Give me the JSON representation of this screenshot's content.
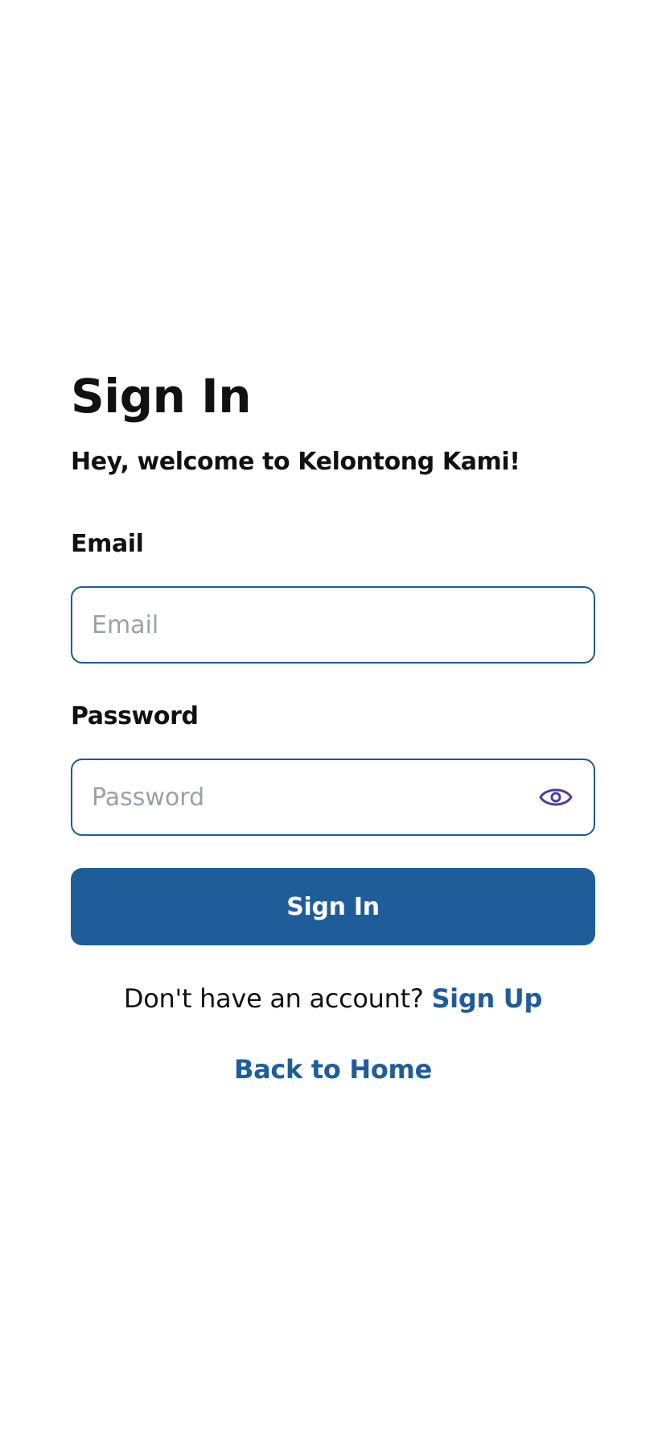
{
  "page": {
    "title": "Sign In",
    "subtitle": "Hey, welcome to Kelontong Kami!"
  },
  "form": {
    "email_label": "Email",
    "email_placeholder": "Email",
    "email_value": "",
    "password_label": "Password",
    "password_placeholder": "Password",
    "password_value": "",
    "password_toggle_icon": "eye-icon",
    "submit_label": "Sign In"
  },
  "footer": {
    "signup_prompt": "Don't have an account?",
    "signup_link": "Sign Up",
    "back_link": "Back to Home"
  },
  "colors": {
    "primary": "#1f5d9a",
    "input_border": "#1f5b99",
    "placeholder": "#9aa1aa",
    "eye_icon": "#4a3f9a",
    "text": "#111111",
    "background": "#ffffff"
  }
}
